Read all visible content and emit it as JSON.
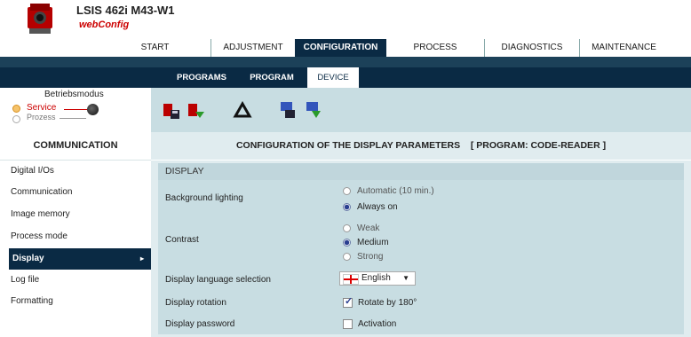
{
  "header": {
    "title": "LSIS 462i M43-W1",
    "subtitle": "webConfig"
  },
  "main_nav": [
    "START",
    "ADJUSTMENT",
    "CONFIGURATION",
    "PROCESS",
    "DIAGNOSTICS",
    "MAINTENANCE"
  ],
  "sub_nav": [
    "PROGRAMS",
    "PROGRAM",
    "DEVICE"
  ],
  "mode": {
    "title": "Betriebsmodus",
    "service": "Service",
    "prozess": "Prozess"
  },
  "toolbar_icons": [
    "load-icon",
    "save-to-device-icon",
    "recycle-icon",
    "upload-to-pc-icon",
    "download-from-pc-icon"
  ],
  "sidebar": {
    "heading": "COMMUNICATION",
    "items": [
      "Digital I/Os",
      "Communication",
      "Image memory",
      "Process mode",
      "Display",
      "Log file",
      "Formatting"
    ]
  },
  "content": {
    "title": "CONFIGURATION OF THE DISPLAY PARAMETERS    [ PROGRAM: CODE-READER ]",
    "section": "DISPLAY",
    "background_lighting": {
      "label": "Background lighting",
      "options": [
        "Automatic (10 min.)",
        "Always on"
      ],
      "selected": "Always on"
    },
    "contrast": {
      "label": "Contrast",
      "options": [
        "Weak",
        "Medium",
        "Strong"
      ],
      "selected": "Medium"
    },
    "language": {
      "label": "Display language selection",
      "value": "English"
    },
    "rotation": {
      "label": "Display rotation",
      "checkbox": "Rotate by 180°",
      "checked": true
    },
    "password": {
      "label": "Display password",
      "checkbox": "Activation",
      "checked": false
    }
  },
  "colors": {
    "nav_dark": "#0a2a44",
    "panel": "#c8dde2",
    "accent_red": "#cc0000"
  }
}
